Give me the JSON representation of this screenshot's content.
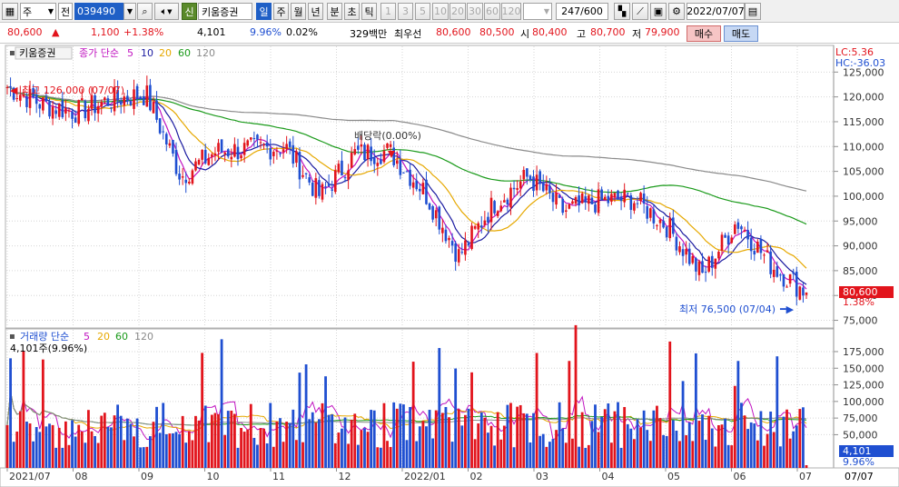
{
  "toolbar": {
    "market": "주",
    "period_type": "전",
    "stock_code": "039490",
    "stock_badge": "신",
    "stock_name": "키움증권",
    "tabs": [
      "일",
      "주",
      "월",
      "년",
      "분",
      "초",
      "틱"
    ],
    "active_tab": "일",
    "numbers": [
      "1",
      "3",
      "5",
      "10",
      "20",
      "30",
      "60",
      "120"
    ],
    "count_value": "247",
    "count_total": "/600",
    "date": "2022/07/07"
  },
  "quote": {
    "price": "80,600",
    "arrow": "▲",
    "change": "1,100",
    "change_pct": "+1.38%",
    "volume": "4,101",
    "volume_ratio": "9.96%",
    "turnover_pct": "0.02%",
    "amount": "329백만",
    "best_label": "최우선",
    "best_ask": "80,600",
    "best_bid": "80,500",
    "open_label": "시",
    "open": "80,400",
    "high_label": "고",
    "high": "80,700",
    "low_label": "저",
    "low": "79,900",
    "buy_btn": "매수",
    "sell_btn": "매도"
  },
  "price_panel": {
    "name": "키움증권",
    "legend_title": "종가 단순",
    "ma_periods": [
      "5",
      "10",
      "20",
      "60",
      "120"
    ],
    "lc": "LC:5.36",
    "hc": "HC:-36.03",
    "high_annot": "최고 126,000 (07/07)",
    "low_annot": "최저 76,500 (07/04)",
    "dividend_annot": "배당락(0.00%)",
    "current_price": "80,600",
    "current_pct": "1.38%"
  },
  "volume_panel": {
    "legend_title": "거래량 단순",
    "ma_periods": [
      "5",
      "20",
      "60",
      "120"
    ],
    "current_label": "4,101주(9.96%)",
    "current_volume": "4,101",
    "current_pct": "9.96%"
  },
  "colors": {
    "up": "#e2141c",
    "down": "#1f4fd1",
    "ma5": "#c014c0",
    "ma10": "#1a1aa0",
    "ma20": "#e6a800",
    "ma60": "#1a9a1a",
    "ma120": "#8a8a8a"
  },
  "chart_data": {
    "type": "candlestick",
    "price_axis": {
      "ticks": [
        75000,
        80000,
        85000,
        90000,
        95000,
        100000,
        105000,
        110000,
        115000,
        120000,
        125000
      ],
      "tick_labels": [
        "75,000",
        "80,000",
        "85,000",
        "90,000",
        "95,000",
        "100,000",
        "105,000",
        "110,000",
        "115,000",
        "120,000",
        "125,000"
      ]
    },
    "volume_axis": {
      "ticks": [
        50000,
        75000,
        100000,
        125000,
        150000,
        175000
      ],
      "tick_labels": [
        "50,000",
        "75,000",
        "100,000",
        "125,000",
        "150,000",
        "175,000"
      ]
    },
    "x_labels": [
      "2021/07",
      "08",
      "09",
      "10",
      "11",
      "12",
      "2022/01",
      "02",
      "03",
      "04",
      "05",
      "06",
      "07"
    ],
    "last_date": "07/07",
    "close_trend": [
      {
        "date": "2021/07",
        "close": 122000
      },
      {
        "date": "08",
        "close": 118500
      },
      {
        "date": "08b",
        "close": 117000
      },
      {
        "date": "09",
        "close": 119500
      },
      {
        "date": "09b",
        "close": 120500
      },
      {
        "date": "10",
        "close": 104000
      },
      {
        "date": "10b",
        "close": 109000
      },
      {
        "date": "11",
        "close": 109500
      },
      {
        "date": "11b",
        "close": 110000
      },
      {
        "date": "12",
        "close": 100000
      },
      {
        "date": "12b",
        "close": 108500
      },
      {
        "date": "2022/01",
        "close": 109000
      },
      {
        "date": "01b",
        "close": 101000
      },
      {
        "date": "02",
        "close": 88000
      },
      {
        "date": "02b",
        "close": 98500
      },
      {
        "date": "03",
        "close": 104000
      },
      {
        "date": "03b",
        "close": 97000
      },
      {
        "date": "04",
        "close": 99000
      },
      {
        "date": "04b",
        "close": 99500
      },
      {
        "date": "05",
        "close": 94000
      },
      {
        "date": "05b",
        "close": 84000
      },
      {
        "date": "06",
        "close": 95000
      },
      {
        "date": "06b",
        "close": 86000
      },
      {
        "date": "07",
        "close": 80600
      }
    ]
  }
}
